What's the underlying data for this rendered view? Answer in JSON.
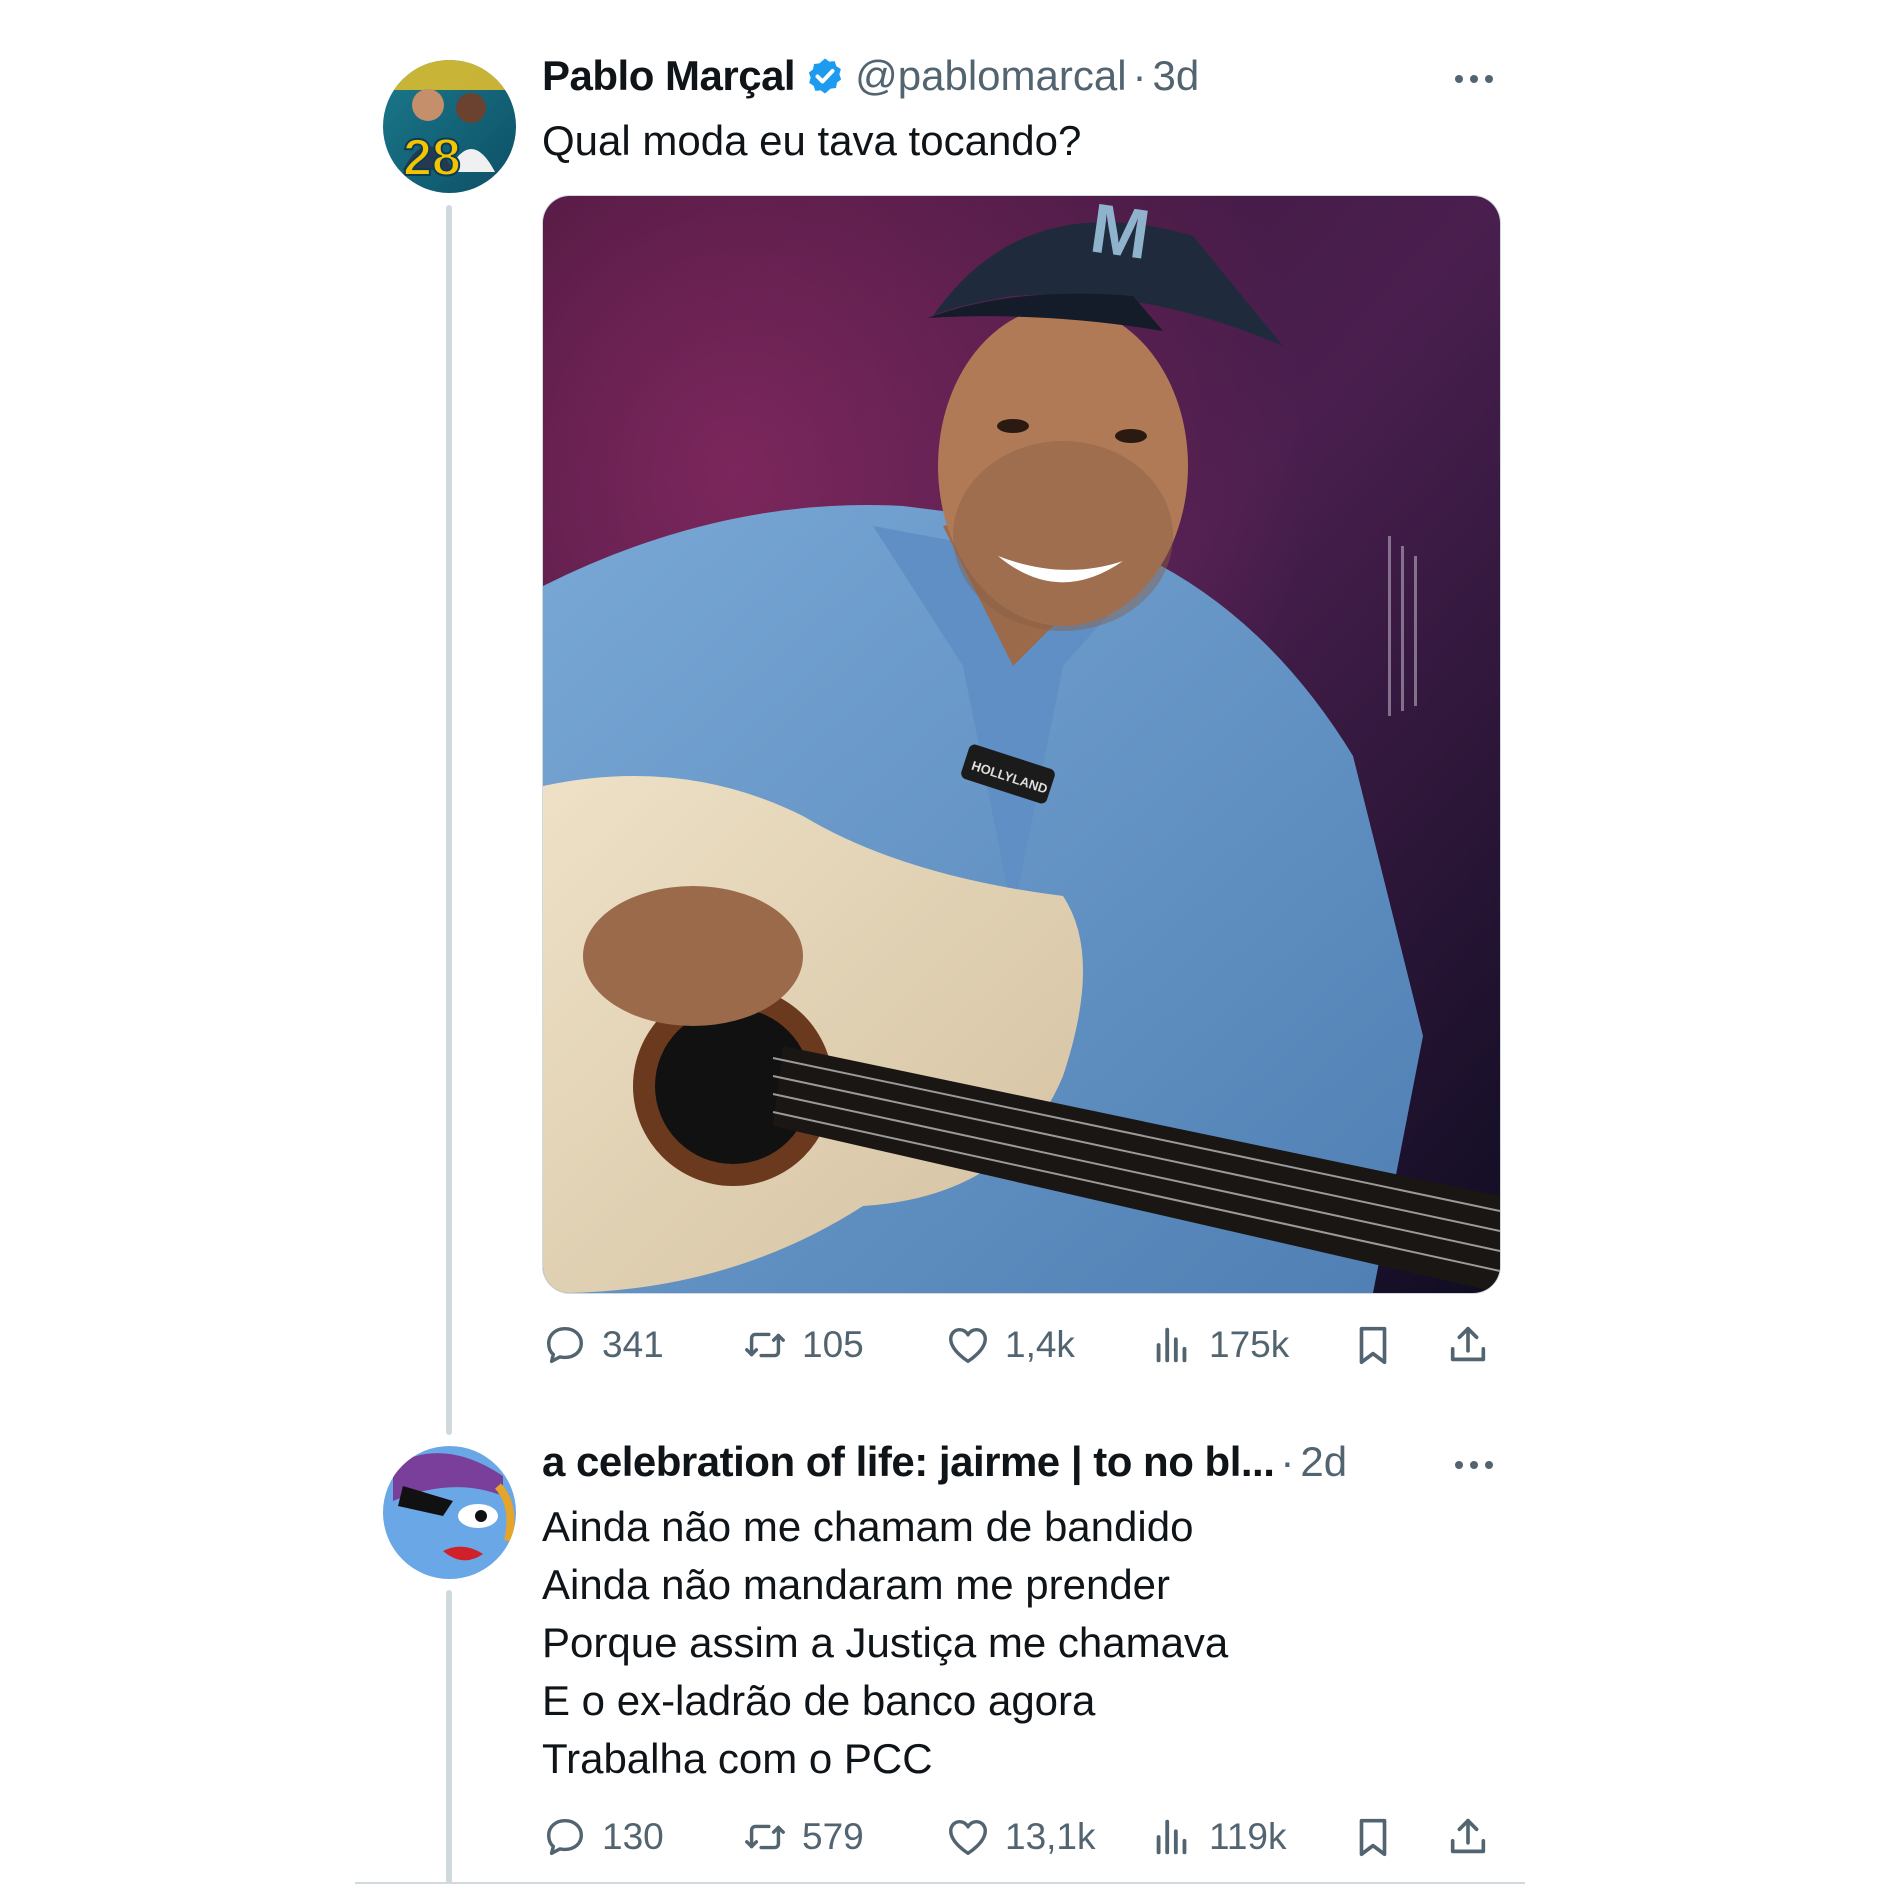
{
  "tweets": [
    {
      "author_name": "Pablo Marçal",
      "verified": true,
      "handle": "@pablomarcal",
      "separator": "·",
      "time": "3d",
      "text": "Qual moda eu tava tocando?",
      "avatar_badge_text": "28",
      "media_overlay_brand": "HOLLYLAND",
      "actions": {
        "replies": "341",
        "retweets": "105",
        "likes": "1,4k",
        "views": "175k"
      }
    },
    {
      "author_name": "a celebration of life: jairme | to no bl...",
      "verified": false,
      "separator": "·",
      "time": "2d",
      "text": "Ainda não me chamam de bandido\nAinda não mandaram me prender\nPorque assim a Justiça me chamava\nE o ex-ladrão de banco agora\nTrabalha com o PCC",
      "actions": {
        "replies": "130",
        "retweets": "579",
        "likes": "13,1k",
        "views": "119k"
      }
    }
  ],
  "colors": {
    "verified": "#1d9bf0",
    "muted": "#536471",
    "thread_line": "#cfd9de"
  },
  "icons": [
    "verified-badge-icon",
    "more-icon",
    "reply-icon",
    "retweet-icon",
    "like-icon",
    "views-icon",
    "bookmark-icon",
    "share-icon"
  ]
}
